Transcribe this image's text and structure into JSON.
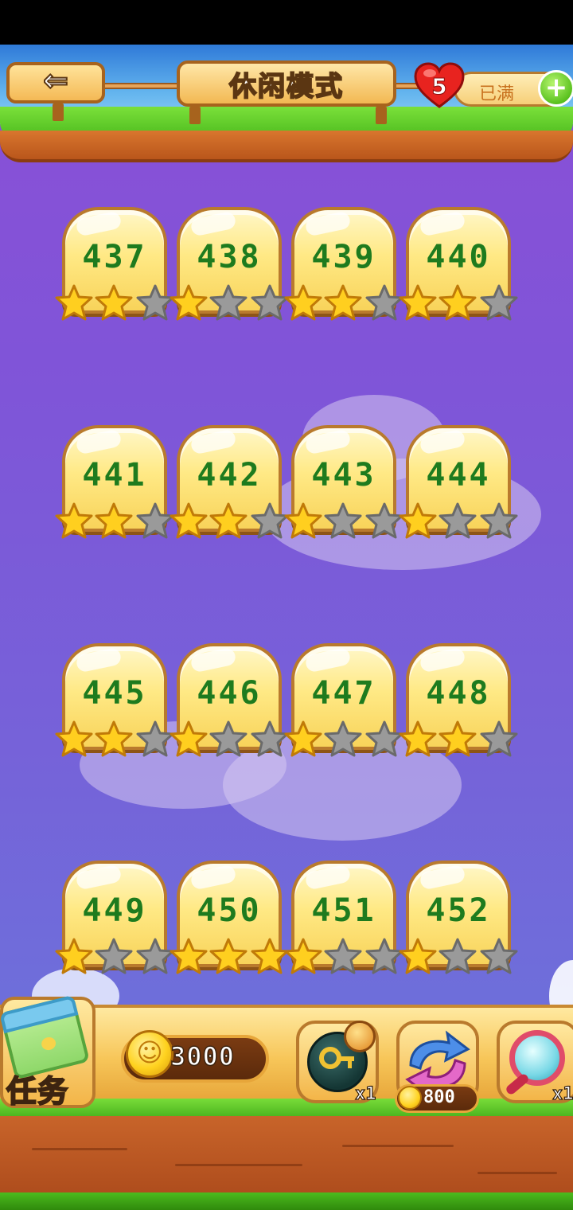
{
  "header": {
    "title": "休闲模式",
    "lives_count": "5",
    "lives_status": "已满"
  },
  "levels": [
    {
      "number": "437",
      "stars": 2
    },
    {
      "number": "438",
      "stars": 1
    },
    {
      "number": "439",
      "stars": 2
    },
    {
      "number": "440",
      "stars": 2
    },
    {
      "number": "441",
      "stars": 2
    },
    {
      "number": "442",
      "stars": 2
    },
    {
      "number": "443",
      "stars": 1
    },
    {
      "number": "444",
      "stars": 1
    },
    {
      "number": "445",
      "stars": 2
    },
    {
      "number": "446",
      "stars": 1
    },
    {
      "number": "447",
      "stars": 1
    },
    {
      "number": "448",
      "stars": 2
    },
    {
      "number": "449",
      "stars": 1
    },
    {
      "number": "450",
      "stars": 3
    },
    {
      "number": "451",
      "stars": 1
    },
    {
      "number": "452",
      "stars": 1
    }
  ],
  "bottom_bar": {
    "task_label": "任务",
    "coins": "3000",
    "items": [
      {
        "name": "key-bomb",
        "count": "x1"
      },
      {
        "name": "swap",
        "price": "800"
      },
      {
        "name": "magnifier",
        "count": "x1"
      }
    ]
  },
  "colors": {
    "star_on": "#ffcf1f",
    "star_off": "#9a9a9a",
    "level_number": "#1e7b1e"
  }
}
